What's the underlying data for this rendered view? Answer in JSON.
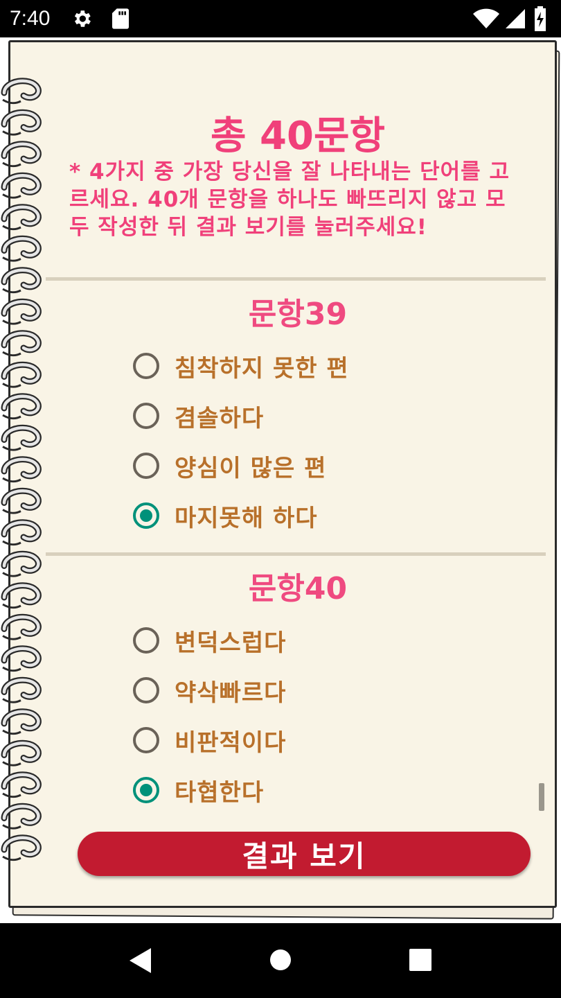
{
  "status_bar": {
    "time": "7:40",
    "icons": [
      "gear-icon",
      "sd-card-icon",
      "wifi-icon",
      "signal-icon",
      "battery-icon"
    ]
  },
  "header": {
    "title": "총 40문항",
    "instructions": "* 4가지 중 가장 당신을 잘 나타내는 단어를 고르세요. 40개 문항을 하나도 빠뜨리지 않고 모두 작성한 뒤 결과 보기를 눌러주세요!"
  },
  "questions": [
    {
      "title": "문항39",
      "options": [
        {
          "label": "침착하지 못한 편",
          "selected": false
        },
        {
          "label": "겸솔하다",
          "selected": false
        },
        {
          "label": "양심이 많은 편",
          "selected": false
        },
        {
          "label": "마지못해 하다",
          "selected": true
        }
      ]
    },
    {
      "title": "문항40",
      "options": [
        {
          "label": "변덕스럽다",
          "selected": false
        },
        {
          "label": "약삭빠르다",
          "selected": false
        },
        {
          "label": "비판적이다",
          "selected": false
        },
        {
          "label": "타협한다",
          "selected": true
        }
      ]
    }
  ],
  "result_button": {
    "label": "결과 보기"
  },
  "nav_bar": {
    "icons": [
      "back-icon",
      "home-icon",
      "recents-icon"
    ]
  },
  "colors": {
    "title_pink": "#f0407a",
    "option_text": "#b8702a",
    "radio_checked": "#00917a",
    "button_red": "#c21b30",
    "paper": "#f9f4e6"
  }
}
